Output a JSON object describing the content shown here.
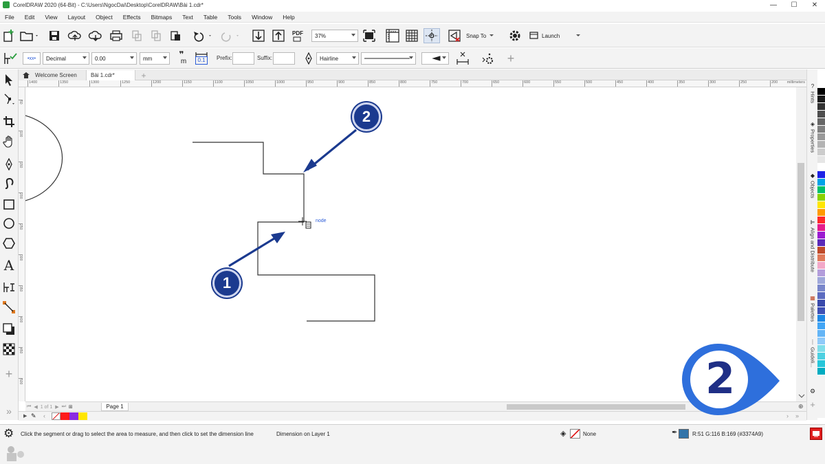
{
  "window": {
    "title": "CorelDRAW 2020 (64-Bit) - C:\\Users\\NgocDai\\Desktop\\CorelDRAW\\Bài 1.cdr*",
    "minimize": "—",
    "maximize": "☐",
    "close": "✕"
  },
  "menu": [
    "File",
    "Edit",
    "View",
    "Layout",
    "Object",
    "Effects",
    "Bitmaps",
    "Text",
    "Table",
    "Tools",
    "Window",
    "Help"
  ],
  "toolbar": {
    "zoom": "37%",
    "snap_to": "Snap To",
    "launch": "Launch",
    "pdf_label": "PDF"
  },
  "property_bar": {
    "style_badge": "•xx•",
    "precision_type": "Decimal",
    "precision_value": "0.00",
    "units": "mm",
    "prefix_label": "Prefix:",
    "suffix_label": "Suffix:",
    "outline_width": "Hairline",
    "dim_text_sample": "0.1",
    "dim_m_sample": "m"
  },
  "tabs": [
    {
      "label": "Welcome Screen"
    },
    {
      "label": "Bài 1.cdr*"
    }
  ],
  "ruler": {
    "top_labels": [
      "1400",
      "1350",
      "1300",
      "1250",
      "1200",
      "1150",
      "1100",
      "1050",
      "1000",
      "950",
      "900",
      "850",
      "800",
      "750",
      "700",
      "650",
      "600",
      "550",
      "500",
      "450",
      "400",
      "350",
      "300",
      "250",
      "200"
    ],
    "units_label": "millimeters",
    "left_labels": [
      "50",
      "100",
      "150",
      "200",
      "250",
      "300",
      "350",
      "400",
      "450",
      "500",
      "550",
      "600",
      "650"
    ]
  },
  "canvas": {
    "node_label": "node"
  },
  "annotations": {
    "badge_top": "2",
    "badge_bottom": "1",
    "logo_number": "2"
  },
  "page_nav": {
    "count": "1 of 1",
    "page_tab": "Page 1"
  },
  "dockers": [
    "Hints",
    "Properties",
    "Objects",
    "Align and Distribute",
    "Palettes",
    "Guideli..."
  ],
  "palette_colors": [
    "#000000",
    "#1a1a1a",
    "#333333",
    "#4d4d4d",
    "#666666",
    "#808080",
    "#999999",
    "#b3b3b3",
    "#cccccc",
    "#e6e6e6",
    "#ffffff",
    "#1e22e6",
    "#00a2e8",
    "#00c06a",
    "#8ad100",
    "#ffe600",
    "#ff9a00",
    "#ff2a2a",
    "#e61e8c",
    "#9b1bd1",
    "#5a2ab8",
    "#c04b2a",
    "#e07a5a",
    "#f2a8c8",
    "#b39ddb",
    "#9fa8da",
    "#7986cb",
    "#5c6bc0",
    "#3949ab",
    "#3f51b5",
    "#1e88e5",
    "#42a5f5",
    "#64b5f6",
    "#90caf9",
    "#80deea",
    "#4dd0e1",
    "#26c6da",
    "#00acc1"
  ],
  "doc_palette": [
    "#ff1a1a",
    "#8a2be2",
    "#ffe600"
  ],
  "status": {
    "hint": "Click the segment or drag to select the area to measure, and then click to set the dimension line",
    "layer": "Dimension on Layer 1",
    "fill_label": "None",
    "outline_color_text": "R:51 G:116 B:169 (#3374A9)",
    "outline_color": "#3374A9"
  },
  "colors": {
    "accent_blue": "#1b3a8f",
    "logo_blue": "#2e6fdc"
  }
}
